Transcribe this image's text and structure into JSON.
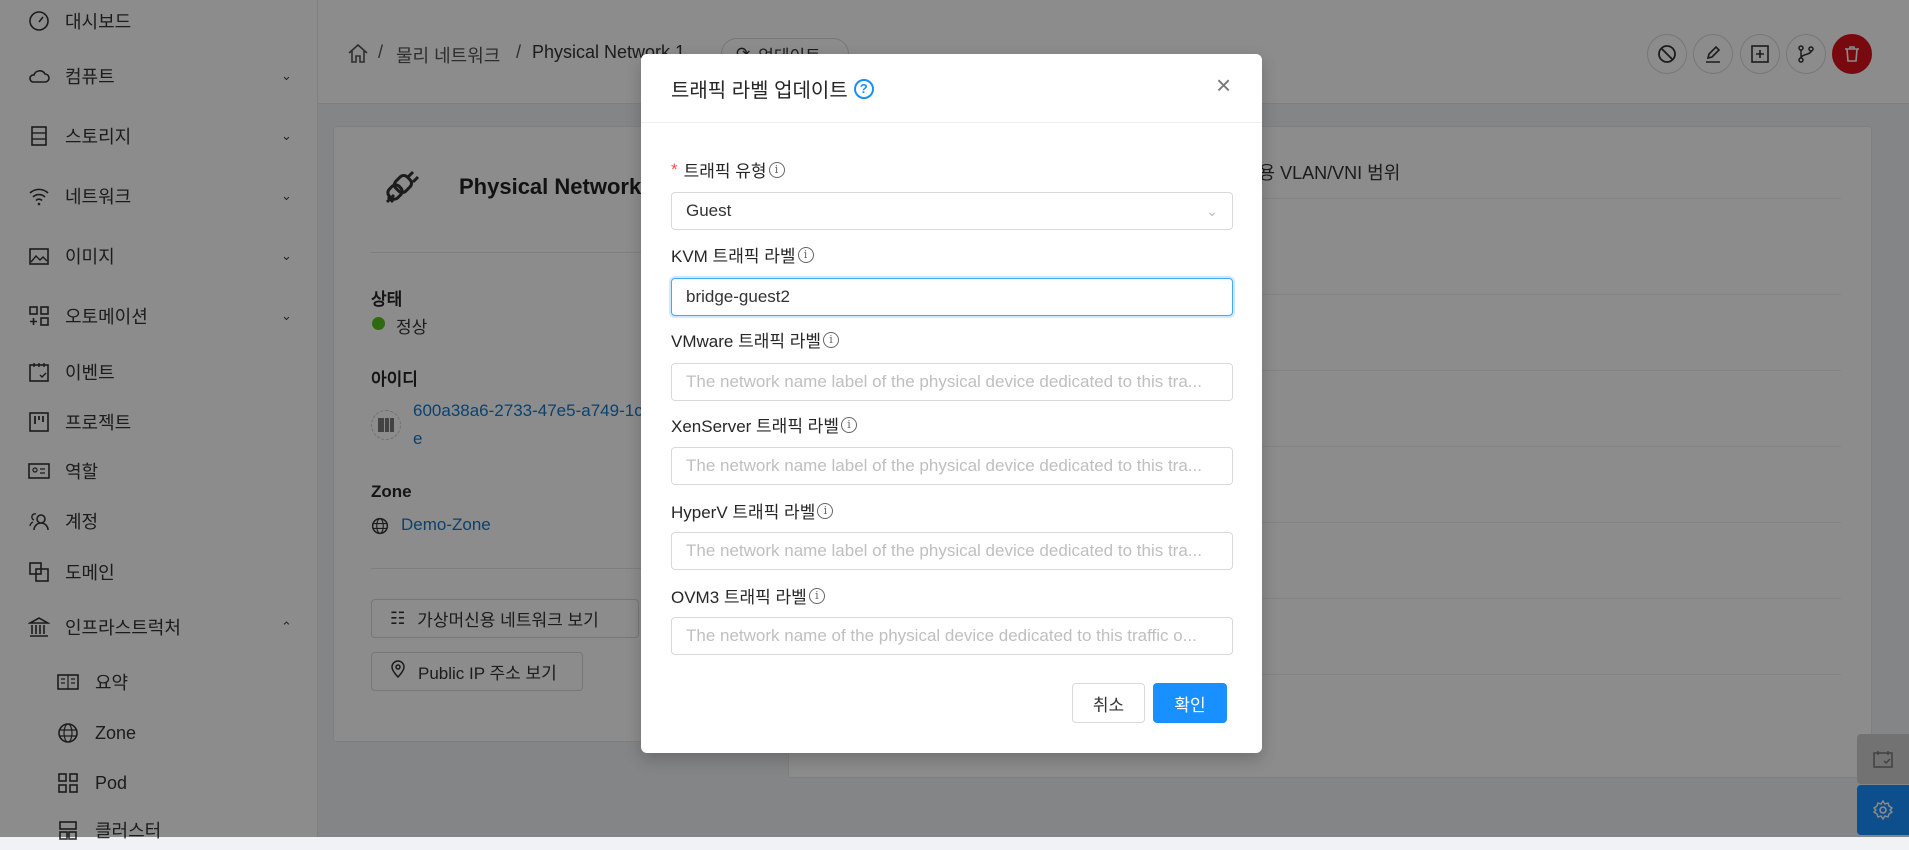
{
  "sidebar": {
    "items": [
      {
        "label": "대시보드",
        "icon": "dashboard-icon"
      },
      {
        "label": "컴퓨트",
        "icon": "cloud-icon",
        "chevron": "down"
      },
      {
        "label": "스토리지",
        "icon": "storage-icon",
        "chevron": "down"
      },
      {
        "label": "네트워크",
        "icon": "wifi-icon",
        "chevron": "down"
      },
      {
        "label": "이미지",
        "icon": "picture-icon",
        "chevron": "down"
      },
      {
        "label": "오토메이션",
        "icon": "automation-icon",
        "chevron": "down"
      },
      {
        "label": "이벤트",
        "icon": "schedule-icon"
      },
      {
        "label": "프로젝트",
        "icon": "project-icon"
      },
      {
        "label": "역할",
        "icon": "idcard-icon"
      },
      {
        "label": "계정",
        "icon": "team-icon"
      },
      {
        "label": "도메인",
        "icon": "block-icon"
      },
      {
        "label": "인프라스트럭처",
        "icon": "bank-icon",
        "chevron": "up"
      }
    ],
    "sub_items": [
      {
        "label": "요약",
        "icon": "read-icon"
      },
      {
        "label": "Zone",
        "icon": "globe-icon"
      },
      {
        "label": "Pod",
        "icon": "appstore-icon"
      },
      {
        "label": "클러스터",
        "icon": "cluster-icon"
      }
    ]
  },
  "breadcrumb": {
    "sep": "/",
    "level1": "물리 네트워크",
    "level2": "Physical Network 1",
    "refresh_label": "업데이트"
  },
  "detail": {
    "title": "Physical Network",
    "state_label": "상태",
    "state_value": "정상",
    "id_label": "아이디",
    "id_line1": "600a38a6-2733-47e5-a749-1c",
    "id_line2": "e",
    "zone_label": "Zone",
    "zone_value": "Demo-Zone",
    "btn_guest_network": "가상머신용 네트워크 보기",
    "btn_public_ip": "Public IP 주소 보기"
  },
  "right_panel": {
    "header": "사용 VLAN/VNI 범위"
  },
  "modal": {
    "title": "트래픽 라벨 업데이트",
    "traffic_type_label": "트래픽 유형",
    "traffic_type_value": "Guest",
    "kvm_label": "KVM 트래픽 라벨",
    "kvm_value": "bridge-guest2",
    "vmware_label": "VMware 트래픽 라벨",
    "vmware_placeholder": "The network name label of the physical device dedicated to this tra...",
    "xen_label": "XenServer 트래픽 라벨",
    "xen_placeholder": "The network name label of the physical device dedicated to this tra...",
    "hyperv_label": "HyperV 트래픽 라벨",
    "hyperv_placeholder": "The network name label of the physical device dedicated to this tra...",
    "ovm3_label": "OVM3 트래픽 라벨",
    "ovm3_placeholder": "The network name of the physical device dedicated to this traffic o...",
    "cancel": "취소",
    "ok": "확인",
    "required_mark": "*",
    "info_glyph": "i"
  },
  "colors": {
    "primary": "#1890ff",
    "danger": "#d9121c",
    "success": "#52c41a",
    "link": "#1677c9"
  }
}
